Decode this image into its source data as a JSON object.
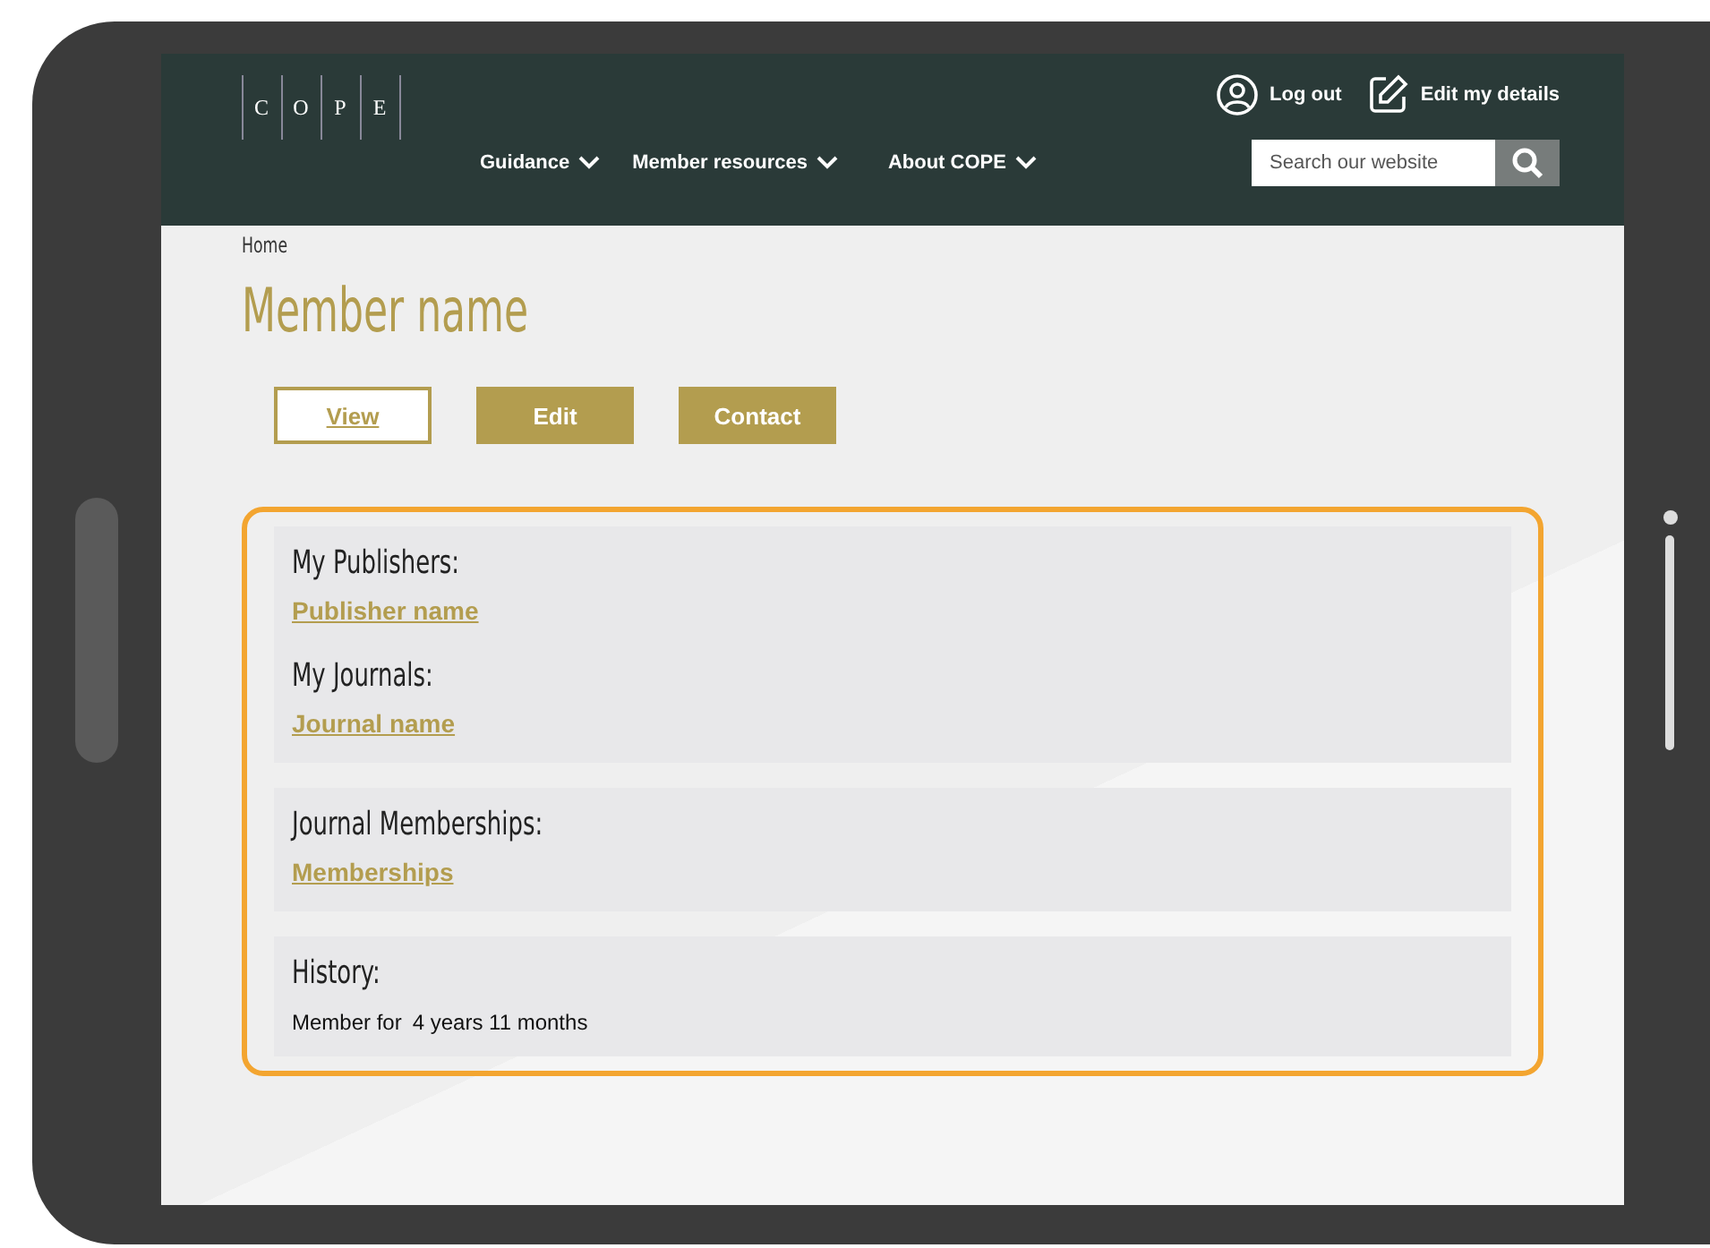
{
  "header": {
    "logo_letters": [
      "C",
      "O",
      "P",
      "E"
    ],
    "user_links": [
      {
        "kind": "user",
        "label": "Log out"
      },
      {
        "kind": "edit",
        "label": "Edit my details"
      }
    ],
    "nav": [
      "Guidance",
      "Member resources",
      "About COPE"
    ],
    "search": {
      "placeholder": "Search our website"
    }
  },
  "breadcrumb": "Home",
  "title": "Member name",
  "tabs": [
    {
      "label": "View",
      "selected": true
    },
    {
      "label": "Edit",
      "selected": false
    },
    {
      "label": "Contact",
      "selected": false
    }
  ],
  "panels": [
    {
      "groups": [
        {
          "kind": "link",
          "heading": "My Publishers:",
          "link": "Publisher name"
        },
        {
          "kind": "link",
          "heading": "My Journals:",
          "link": "Journal name"
        }
      ]
    },
    {
      "groups": [
        {
          "kind": "link",
          "heading": "Journal Memberships:",
          "link": "Memberships"
        }
      ]
    },
    {
      "groups": [
        {
          "kind": "text",
          "heading": "History:",
          "label": "Member for",
          "value": "4 years 11 months"
        }
      ]
    }
  ]
}
